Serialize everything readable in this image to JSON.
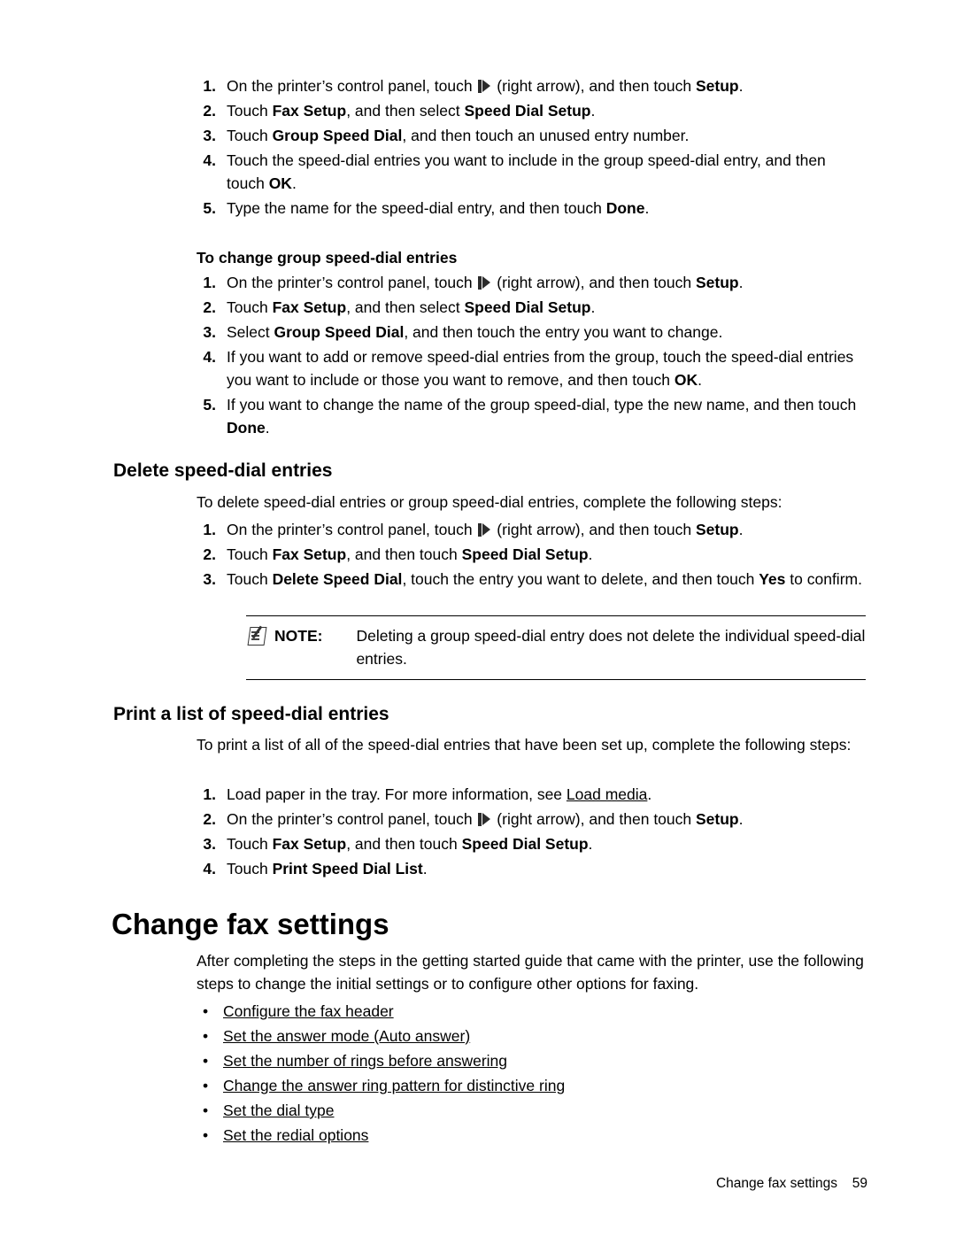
{
  "doc": {
    "top_steps": [
      {
        "num": "1.",
        "pre": "On the printer’s control panel, touch ",
        "post_plain": " (right arrow), and then touch ",
        "bold_tail": "Setup",
        "end": ".",
        "icon": true
      },
      {
        "num": "2.",
        "text_runs": [
          {
            "t": "Touch ",
            "b": false
          },
          {
            "t": "Fax Setup",
            "b": true
          },
          {
            "t": ", and then select ",
            "b": false
          },
          {
            "t": "Speed Dial Setup",
            "b": true
          },
          {
            "t": ".",
            "b": false
          }
        ]
      },
      {
        "num": "3.",
        "text_runs": [
          {
            "t": "Touch ",
            "b": false
          },
          {
            "t": "Group Speed Dial",
            "b": true
          },
          {
            "t": ", and then touch an unused entry number.",
            "b": false
          }
        ]
      },
      {
        "num": "4.",
        "text_runs": [
          {
            "t": "Touch the speed-dial entries you want to include in the group speed-dial entry, and then touch ",
            "b": false
          },
          {
            "t": "OK",
            "b": true
          },
          {
            "t": ".",
            "b": false
          }
        ]
      },
      {
        "num": "5.",
        "text_runs": [
          {
            "t": "Type the name for the speed-dial entry, and then touch ",
            "b": false
          },
          {
            "t": "Done",
            "b": true
          },
          {
            "t": ".",
            "b": false
          }
        ]
      }
    ],
    "change_group_heading": "To change group speed-dial entries",
    "change_group_steps": [
      {
        "num": "1.",
        "pre": "On the printer’s control panel, touch ",
        "post_plain": " (right arrow), and then touch ",
        "bold_tail": "Setup",
        "end": ".",
        "icon": true
      },
      {
        "num": "2.",
        "text_runs": [
          {
            "t": "Touch ",
            "b": false
          },
          {
            "t": "Fax Setup",
            "b": true
          },
          {
            "t": ", and then select ",
            "b": false
          },
          {
            "t": "Speed Dial Setup",
            "b": true
          },
          {
            "t": ".",
            "b": false
          }
        ]
      },
      {
        "num": "3.",
        "text_runs": [
          {
            "t": "Select ",
            "b": false
          },
          {
            "t": "Group Speed Dial",
            "b": true
          },
          {
            "t": ", and then touch the entry you want to change.",
            "b": false
          }
        ]
      },
      {
        "num": "4.",
        "text_runs": [
          {
            "t": "If you want to add or remove speed-dial entries from the group, touch the speed-dial entries you want to include or those you want to remove, and then touch ",
            "b": false
          },
          {
            "t": "OK",
            "b": true
          },
          {
            "t": ".",
            "b": false
          }
        ]
      },
      {
        "num": "5.",
        "text_runs": [
          {
            "t": "If you want to change the name of the group speed-dial, type the new name, and then touch ",
            "b": false
          },
          {
            "t": "Done",
            "b": true
          },
          {
            "t": ".",
            "b": false
          }
        ]
      }
    ],
    "delete_heading": "Delete speed-dial entries",
    "delete_intro": "To delete speed-dial entries or group speed-dial entries, complete the following steps:",
    "delete_steps": [
      {
        "num": "1.",
        "pre": "On the printer’s control panel, touch ",
        "post_plain": " (right arrow), and then touch ",
        "bold_tail": "Setup",
        "end": ".",
        "icon": true
      },
      {
        "num": "2.",
        "text_runs": [
          {
            "t": "Touch ",
            "b": false
          },
          {
            "t": "Fax Setup",
            "b": true
          },
          {
            "t": ", and then touch ",
            "b": false
          },
          {
            "t": "Speed Dial Setup",
            "b": true
          },
          {
            "t": ".",
            "b": false
          }
        ]
      },
      {
        "num": "3.",
        "text_runs": [
          {
            "t": "Touch ",
            "b": false
          },
          {
            "t": "Delete Speed Dial",
            "b": true
          },
          {
            "t": ", touch the entry you want to delete, and then touch ",
            "b": false
          },
          {
            "t": "Yes",
            "b": true
          },
          {
            "t": " to confirm.",
            "b": false
          }
        ]
      }
    ],
    "note": {
      "label": "NOTE:",
      "text": "Deleting a group speed-dial entry does not delete the individual speed-dial entries."
    },
    "print_heading": "Print a list of speed-dial entries",
    "print_intro": "To print a list of all of the speed-dial entries that have been set up, complete the following steps:",
    "print_steps": [
      {
        "num": "1.",
        "text_runs": [
          {
            "t": "Load paper in the tray. For more information, see ",
            "b": false
          },
          {
            "t": "Load media",
            "b": false,
            "link": true
          },
          {
            "t": ".",
            "b": false
          }
        ]
      },
      {
        "num": "2.",
        "pre": "On the printer’s control panel, touch ",
        "post_plain": " (right arrow), and then touch ",
        "bold_tail": "Setup",
        "end": ".",
        "icon": true
      },
      {
        "num": "3.",
        "text_runs": [
          {
            "t": "Touch ",
            "b": false
          },
          {
            "t": "Fax Setup",
            "b": true
          },
          {
            "t": ", and then touch ",
            "b": false
          },
          {
            "t": "Speed Dial Setup",
            "b": true
          },
          {
            "t": ".",
            "b": false
          }
        ]
      },
      {
        "num": "4.",
        "text_runs": [
          {
            "t": "Touch ",
            "b": false
          },
          {
            "t": "Print Speed Dial List",
            "b": true
          },
          {
            "t": ".",
            "b": false
          }
        ]
      }
    ],
    "chapter_title": "Change fax settings",
    "chapter_intro": "After completing the steps in the getting started guide that came with the printer, use the following steps to change the initial settings or to configure other options for faxing.",
    "chapter_links": [
      "Configure the fax header",
      "Set the answer mode (Auto answer)",
      "Set the number of rings before answering",
      "Change the answer ring pattern for distinctive ring",
      "Set the dial type",
      "Set the redial options"
    ],
    "footer": {
      "text": "Change fax settings",
      "page": "59"
    }
  }
}
